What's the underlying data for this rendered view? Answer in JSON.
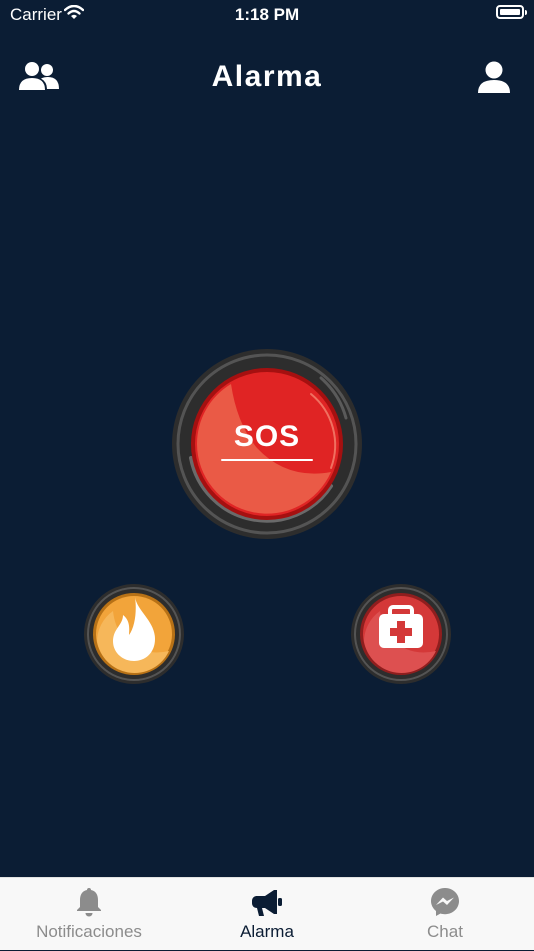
{
  "status": {
    "carrier": "Carrier",
    "time": "1:18 PM"
  },
  "header": {
    "title": "Alarma",
    "left_icon": "group-icon",
    "right_icon": "user-icon"
  },
  "main": {
    "sos_button": {
      "label": "SOS",
      "color": "#e02424"
    },
    "fire_button": {
      "icon": "fire-icon",
      "color": "#f2a43a"
    },
    "medical_button": {
      "icon": "first-aid-kit-icon",
      "color": "#d43838"
    }
  },
  "tabs": [
    {
      "label": "Notificaciones",
      "icon": "bell-icon",
      "active": false
    },
    {
      "label": "Alarma",
      "icon": "megaphone-icon",
      "active": true
    },
    {
      "label": "Chat",
      "icon": "messenger-icon",
      "active": false
    }
  ],
  "colors": {
    "background": "#0b1d34",
    "tab_active": "#0b1d34",
    "tab_inactive": "#8c8c8c"
  }
}
